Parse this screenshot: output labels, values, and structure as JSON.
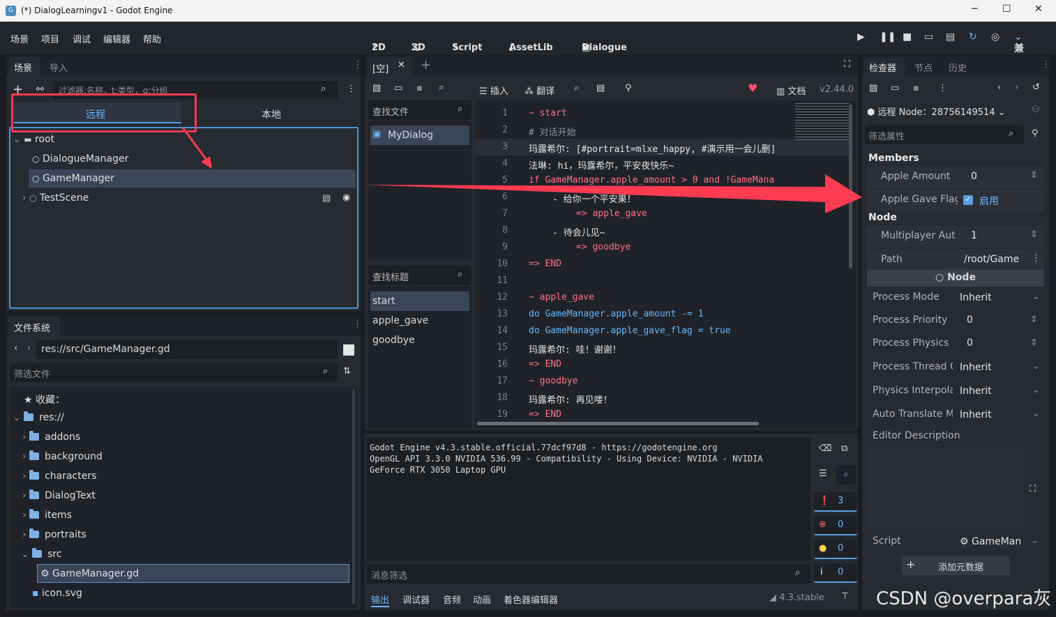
{
  "window": {
    "title": "(*) DialogLearningv1 - Godot Engine",
    "minimize": "─",
    "maximize": "☐",
    "close": "✕"
  },
  "menu": [
    "场景",
    "项目",
    "调试",
    "编辑器",
    "帮助"
  ],
  "workspaces": {
    "w2d": "2D",
    "w3d": "3D",
    "script": "Script",
    "assetlib": "AssetLib",
    "dialogue": "Dialogue"
  },
  "renderer": "兼容",
  "scene_dock": {
    "tabs": [
      "场景",
      "导入"
    ],
    "filter_placeholder": "过滤器:名称，t:类型，g:分组",
    "remote": "远程",
    "local": "本地",
    "nodes": [
      {
        "name": "root",
        "depth": 0
      },
      {
        "name": "DialogueManager",
        "depth": 1
      },
      {
        "name": "GameManager",
        "depth": 1
      },
      {
        "name": "TestScene",
        "depth": 1
      }
    ]
  },
  "filesystem": {
    "title": "文件系统",
    "path": "res://src/GameManager.gd",
    "filter_placeholder": "筛选文件",
    "favorites": "收藏：",
    "root": "res://",
    "folders": [
      "addons",
      "background",
      "characters",
      "DialogText",
      "items",
      "portraits",
      "src"
    ],
    "selected_file": "GameManager.gd",
    "other_file": "icon.svg"
  },
  "dialogue_editor": {
    "tab": "[空]",
    "toolbar": {
      "insert": "插入",
      "translate": "翻译",
      "docs": "文档",
      "version": "v2.44.0"
    },
    "find_files": "查找文件",
    "files": [
      "MyDialog"
    ],
    "find_titles": "查找标题",
    "titles": [
      "start",
      "apple_gave",
      "goodbye"
    ],
    "lines": [
      "~ start",
      "# 对话开始",
      "玛露希尔: [#portrait=mlxe_happy, #演示用一会儿删]",
      "法琳: hi，玛露希尔，平安夜快乐~",
      "if GameManager.apple_amount > 0 and !GameMana",
      "- 给你一个平安果！",
      "=> apple_gave",
      "- 待会儿见~",
      "=> goodbye",
      "=> END",
      "",
      "~ apple_gave",
      "do GameManager.apple_amount -= 1",
      "do GameManager.apple_gave_flag = true",
      "玛露希尔: 哇！谢谢！",
      "=> END",
      "~ goodbye",
      "玛露希尔: 再见喽！",
      "=> END"
    ]
  },
  "output": {
    "text": "Godot Engine v4.3.stable.official.77dcf97d8 - https://godotengine.org\nOpenGL API 3.3.0 NVIDIA 536.99 - Compatibility - Using Device: NVIDIA - NVIDIA\nGeForce RTX 3050 Laptop GPU",
    "counts": [
      "3",
      "0",
      "0",
      "0"
    ],
    "filter_placeholder": "消息筛选",
    "bottom_tabs": [
      "输出",
      "调试器",
      "音频",
      "动画",
      "着色器编辑器"
    ],
    "version": "4.3.stable"
  },
  "inspector": {
    "tabs": [
      "检查器",
      "节点",
      "历史"
    ],
    "remote_node": "远程 Node：28756149514",
    "filter_placeholder": "筛选属性",
    "members_title": "Members",
    "apple_amount_label": "Apple Amount",
    "apple_amount": "0",
    "apple_gave_flag_label": "Apple Gave Flag",
    "apple_gave_flag": "启用",
    "node_title": "Node",
    "multiplayer_label": "Multiplayer Aut",
    "multiplayer": "1",
    "path_label": "Path",
    "path": "/root/Game",
    "node_section": "Node",
    "props": [
      {
        "label": "Process Mode",
        "value": "Inherit"
      },
      {
        "label": "Process Priority",
        "value": "0"
      },
      {
        "label": "Process Physics P",
        "value": "0"
      },
      {
        "label": "Process Thread G",
        "value": "Inherit"
      },
      {
        "label": "Physics Interpola",
        "value": "Inherit"
      },
      {
        "label": "Auto Translate M",
        "value": "Inherit"
      }
    ],
    "editor_description": "Editor Description",
    "script_label": "Script",
    "script_value": "GameMan",
    "add_metadata": "添加元数据"
  },
  "watermark": "CSDN @overpara灰",
  "colors": {
    "accent": "#6fb4ff",
    "annotation": "#ff3b52",
    "selection": "#3a4658"
  }
}
